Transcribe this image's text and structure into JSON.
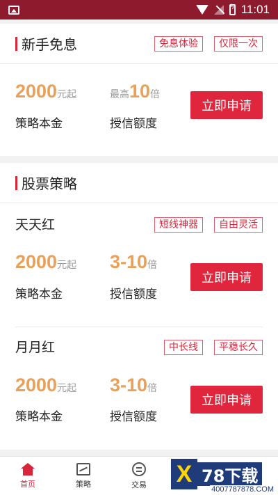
{
  "status_bar": {
    "time": "11:01"
  },
  "sec1": {
    "title": "新手免息",
    "tags": [
      "免息体验",
      "仅限一次"
    ],
    "amount": "2000",
    "amount_unit": "元起",
    "rate_prefix": "最高",
    "rate": "10",
    "rate_unit": "倍",
    "label_left": "策略本金",
    "label_right": "授信额度",
    "button": "立即申请"
  },
  "sec2": {
    "title": "股票策略",
    "items": [
      {
        "title": "天天红",
        "tags": [
          "短线神器",
          "自由灵活"
        ],
        "amount": "2000",
        "amount_unit": "元起",
        "rate": "3-10",
        "rate_unit": "倍",
        "label_left": "策略本金",
        "label_right": "授信额度",
        "button": "立即申请"
      },
      {
        "title": "月月红",
        "tags": [
          "中长线",
          "平稳长久"
        ],
        "amount": "2000",
        "amount_unit": "元起",
        "rate": "3-10",
        "rate_unit": "倍",
        "label_left": "策略本金",
        "label_right": "授信额度",
        "button": "立即申请"
      }
    ]
  },
  "nav": {
    "tabs": [
      {
        "label": "首页",
        "icon": "home-icon"
      },
      {
        "label": "策略",
        "icon": "chart-icon"
      },
      {
        "label": "交易",
        "icon": "trade-icon"
      },
      {
        "label": "",
        "icon": "user-icon"
      },
      {
        "label": "",
        "icon": "grid-icon"
      }
    ]
  },
  "watermark": {
    "logo": "X",
    "text": "78下载",
    "url": "4007787878.COM"
  },
  "colors": {
    "status_bar": "#8e1a2e",
    "accent": "#e0263d",
    "number": "#e9a159"
  }
}
